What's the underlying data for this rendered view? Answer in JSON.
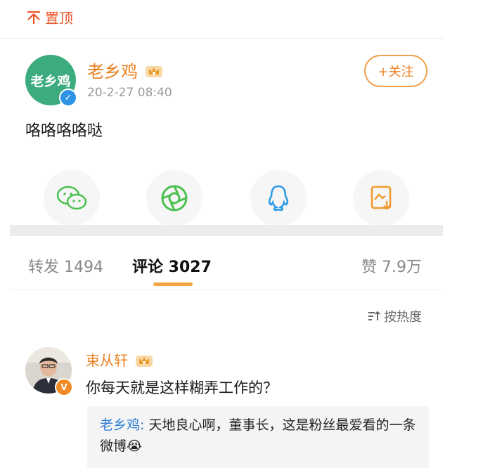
{
  "pin": {
    "label": "置顶"
  },
  "post": {
    "author": "老乡鸡",
    "avatar_text": "老乡鸡",
    "badge": "✓",
    "time": "20-2-27 08:40",
    "follow_label": "+关注",
    "text": "咯咯咯咯哒"
  },
  "share_icons": [
    "wechat-icon",
    "moments-icon",
    "qq-icon",
    "save-image-icon"
  ],
  "tabs": {
    "repost": "转发 1494",
    "comment": "评论 3027",
    "like": "赞 7.9万"
  },
  "sort": {
    "label": "按热度"
  },
  "comment": {
    "author": "束从轩",
    "badge": "V",
    "text": "你每天就是这样糊弄工作的？",
    "reply_author": "老乡鸡:",
    "reply_text": " 天地良心啊，董事长，这是粉丝最爱看的一条微博",
    "reply_emoji": "😭"
  },
  "colors": {
    "accent": "#ea7f1c",
    "link": "#2e7ed6",
    "verified": "#2e95e6",
    "tab_indicator": "#f0a540"
  }
}
